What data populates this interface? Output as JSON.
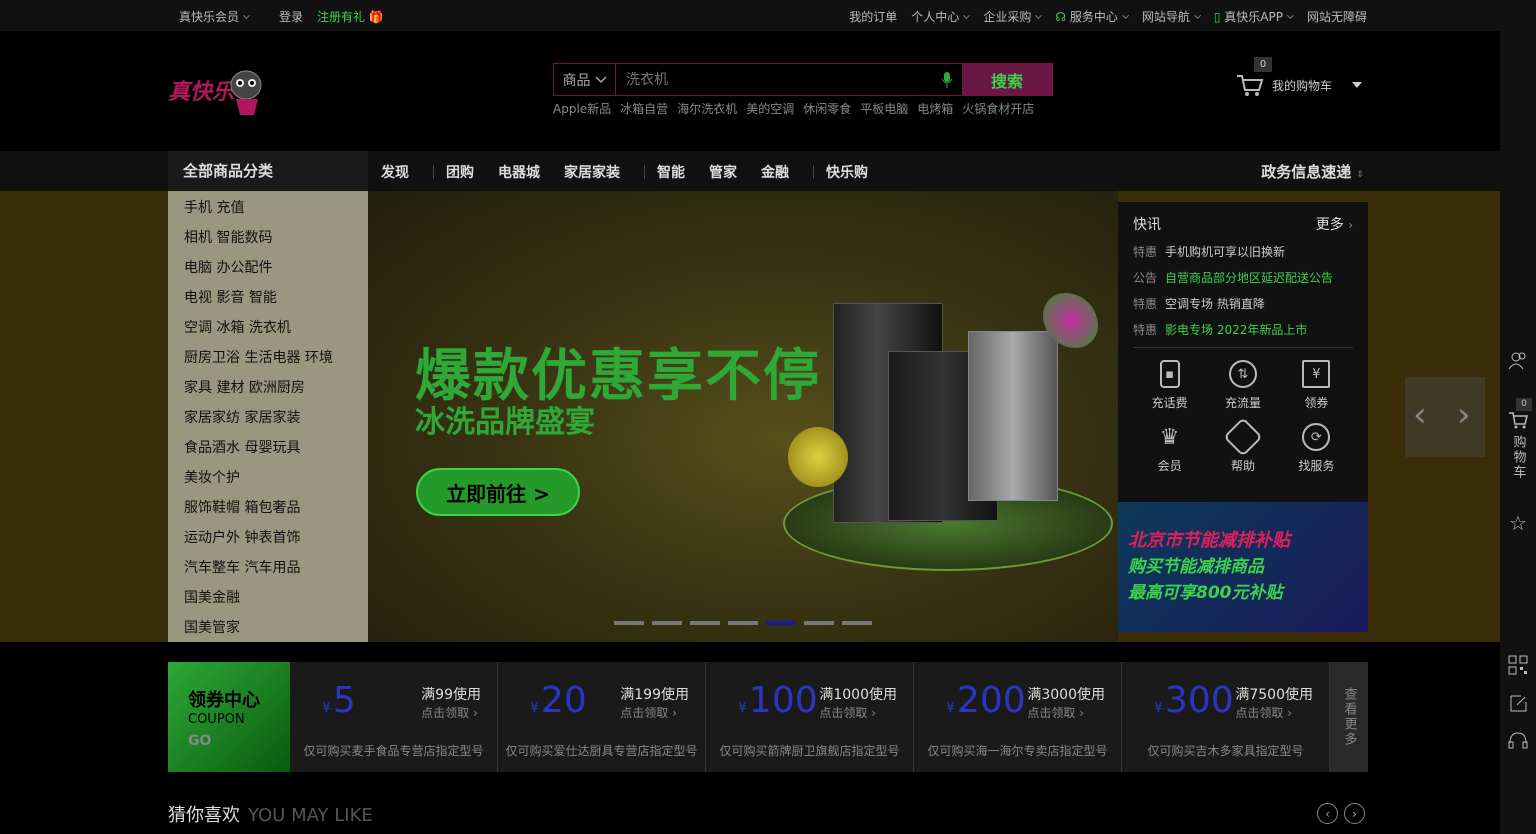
{
  "topbar": {
    "left": [
      "真快乐会员",
      "登录",
      "注册有礼"
    ],
    "right": [
      "我的订单",
      "个人中心",
      "企业采购",
      "服务中心",
      "网站导航",
      "真快乐APP",
      "网站无障碍"
    ]
  },
  "header": {
    "logo_text": "真快乐",
    "search_category": "商品",
    "search_placeholder": "洗衣机",
    "search_button": "搜索",
    "hot_words": [
      "Apple新品",
      "冰箱自营",
      "海尔洗衣机",
      "美的空调",
      "休闲零食",
      "平板电脑",
      "电烤箱",
      "火锅食材开店"
    ],
    "cart_label": "我的购物车",
    "cart_count": "0"
  },
  "nav": {
    "all_categories": "全部商品分类",
    "items": [
      "发现",
      "团购",
      "电器城",
      "家居家装",
      "智能",
      "管家",
      "金融",
      "快乐购"
    ],
    "gov_news": "政务信息速递"
  },
  "side_categories": [
    "手机 充值",
    "相机 智能数码",
    "电脑 办公配件",
    "电视 影音 智能",
    "空调 冰箱 洗衣机",
    "厨房卫浴 生活电器 环境",
    "家具 建材 欧洲厨房",
    "家居家纺 家居家装",
    "食品酒水 母婴玩具",
    "美妆个护",
    "服饰鞋帽 箱包奢品",
    "运动户外 钟表首饰",
    "汽车整车 汽车用品",
    "国美金融",
    "国美管家"
  ],
  "hero": {
    "title": "爆款优惠享不停",
    "subtitle": "冰洗品牌盛宴",
    "cta": "立即前往 >",
    "dots_total": 7,
    "dots_active": 5
  },
  "news": {
    "title": "快讯",
    "more": "更多",
    "items": [
      {
        "tag": "特惠",
        "text": "手机购机可享以旧换新",
        "highlight": false
      },
      {
        "tag": "公告",
        "text": "自营商品部分地区延迟配送公告",
        "highlight": true
      },
      {
        "tag": "特惠",
        "text": "空调专场 热销直降",
        "highlight": false
      },
      {
        "tag": "特惠",
        "text": "影电专场 2022年新品上市",
        "highlight": true
      }
    ],
    "services": [
      {
        "label": "充话费",
        "icon": "phone-icon"
      },
      {
        "label": "充流量",
        "icon": "traffic-icon"
      },
      {
        "label": "领券",
        "icon": "coupon-icon"
      },
      {
        "label": "会员",
        "icon": "crown-icon"
      },
      {
        "label": "帮助",
        "icon": "help-icon"
      },
      {
        "label": "找服务",
        "icon": "service-icon"
      }
    ]
  },
  "ad": {
    "line1": "北京市节能减排补贴",
    "line2": "购买节能减排商品",
    "line3": "最高可享800元补贴"
  },
  "coupons": {
    "center_title": "领券中心",
    "center_sub": "COUPON",
    "center_go": "GO",
    "currency": "¥",
    "items": [
      {
        "amount": "5",
        "condition": "满99使用",
        "action": "点击领取",
        "desc": "仅可购买麦手食品专营店指定型号"
      },
      {
        "amount": "20",
        "condition": "满199使用",
        "action": "点击领取",
        "desc": "仅可购买爱仕达厨具专营店指定型号"
      },
      {
        "amount": "100",
        "condition": "满1000使用",
        "action": "点击领取",
        "desc": "仅可购买箭牌厨卫旗舰店指定型号"
      },
      {
        "amount": "200",
        "condition": "满3000使用",
        "action": "点击领取",
        "desc": "仅可购买海一海尔专卖店指定型号"
      },
      {
        "amount": "300",
        "condition": "满7500使用",
        "action": "点击领取",
        "desc": "仅可购买吉木多家具指定型号"
      }
    ],
    "view_more": "查看更多"
  },
  "guess": {
    "title": "猜你喜欢",
    "subtitle": "YOU MAY LIKE"
  },
  "right_bar": {
    "cart_label": "购物车",
    "cart_count": "0"
  }
}
